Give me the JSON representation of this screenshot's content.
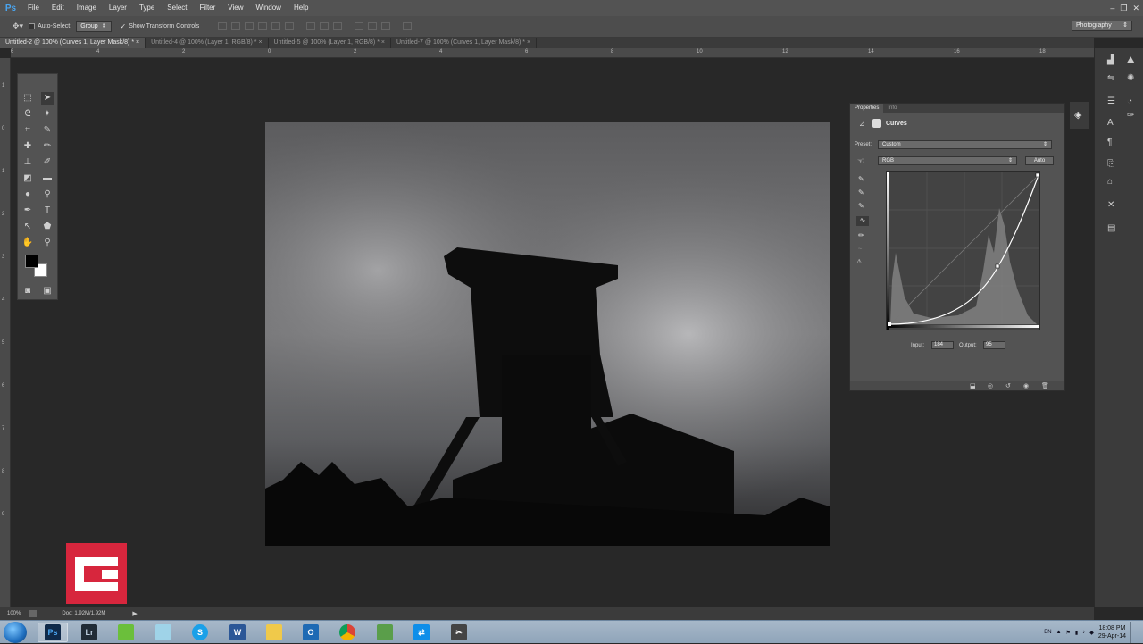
{
  "app": {
    "logo": "Ps",
    "menu": [
      "File",
      "Edit",
      "Image",
      "Layer",
      "Type",
      "Select",
      "Filter",
      "View",
      "Window",
      "Help"
    ],
    "window_controls": {
      "minimize": "–",
      "restore": "❐",
      "close": "✕"
    }
  },
  "options_bar": {
    "auto_select_label": "Auto-Select:",
    "auto_select_value": "Group",
    "transform_controls_label": "Show Transform Controls",
    "workspace": "Photography"
  },
  "tabs": [
    {
      "label": "Untitled-2 @ 100% (Curves 1, Layer Mask/8) *",
      "active": true
    },
    {
      "label": "Untitled-4 @ 100% (Layer 1, RGB/8) *",
      "active": false
    },
    {
      "label": "Untitled-5 @ 100% (Layer 1, RGB/8) *",
      "active": false
    },
    {
      "label": "Untitled-7 @ 100% (Curves 1, Layer Mask/8) *",
      "active": false
    }
  ],
  "ruler": {
    "h_labels": [
      "6",
      "4",
      "2",
      "0",
      "2",
      "4",
      "6",
      "8",
      "10",
      "12",
      "14",
      "16",
      "18"
    ],
    "v_labels": [
      "1",
      "0",
      "1",
      "2",
      "3",
      "4",
      "5",
      "6",
      "7",
      "8",
      "9"
    ]
  },
  "properties": {
    "tabs": [
      "Properties",
      "Info"
    ],
    "title": "Curves",
    "preset_label": "Preset:",
    "preset_value": "Custom",
    "channel_value": "RGB",
    "auto_label": "Auto",
    "input_label": "Input:",
    "input_value": "184",
    "output_label": "Output:",
    "output_value": "95"
  },
  "status": {
    "zoom": "100%",
    "doc": "Doc: 1.92M/1.92M"
  },
  "taskbar": {
    "apps": [
      "Ps",
      "Lr",
      "Evernote",
      "File",
      "Skype",
      "Word",
      "Explorer",
      "Outlook",
      "Chrome",
      "Spotify",
      "TeamViewer",
      "Tool"
    ],
    "language": "EN",
    "time": "18:08 PM",
    "date": "29-Apr-14"
  },
  "colors": {
    "accent_blue": "#4aa5f0",
    "brand_red": "#d7263d"
  }
}
